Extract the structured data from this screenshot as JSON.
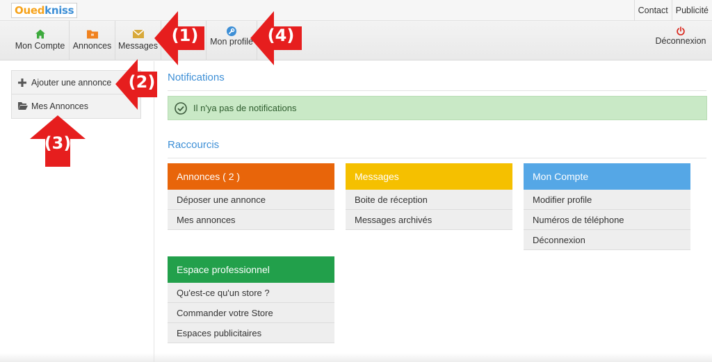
{
  "logo": {
    "part1": "Oued",
    "part2": "kniss"
  },
  "top_links": {
    "contact": "Contact",
    "ads": "Publicité"
  },
  "toolbar": {
    "mon_compte": "Mon Compte",
    "annonces": "Annonces",
    "messages": "Messages",
    "mon_profile": "Mon profile",
    "deconnexion": "Déconnexion"
  },
  "sidebar": {
    "add": "Ajouter une annonce",
    "mine": "Mes Annonces"
  },
  "notifications": {
    "title": "Notifications",
    "empty": "Il n'ya pas de notifications"
  },
  "shortcuts": {
    "title": "Raccourcis",
    "cards": [
      {
        "title": "Annonces ( 2 )",
        "color": "#e8650a",
        "items": [
          "Déposer une annonce",
          "Mes annonces"
        ]
      },
      {
        "title": "Messages",
        "color": "#f5c000",
        "items": [
          "Boite de réception",
          "Messages archivés"
        ]
      },
      {
        "title": "Mon Compte",
        "color": "#55a7e6",
        "items": [
          "Modifier profile",
          "Numéros de téléphone",
          "Déconnexion"
        ]
      },
      {
        "title": "Espace professionnel",
        "color": "#22a04b",
        "items": [
          "Qu'est-ce qu'un store ?",
          "Commander votre Store",
          "Espaces publicitaires"
        ]
      }
    ]
  },
  "annotations": [
    "(1)",
    "(2)",
    "(3)",
    "(4)"
  ],
  "colors": {
    "accent_blue": "#3d8fd6",
    "arrow_red": "#e61e1e",
    "success_bg": "#c9e9c6",
    "logout_red": "#d9261c"
  },
  "icons": {
    "mon_compte": "home-icon",
    "annonces": "folder-icon",
    "messages": "envelope-icon",
    "mon_profile": "wrench-icon",
    "deconnexion": "power-icon",
    "add": "plus-icon",
    "mine": "folder-open-icon",
    "notice": "check-circle-icon"
  }
}
